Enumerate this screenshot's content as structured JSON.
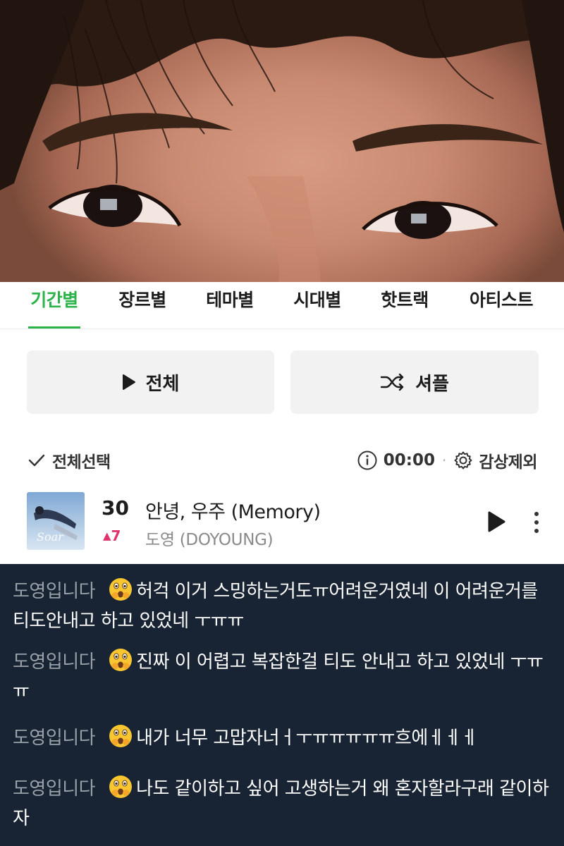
{
  "tabs": [
    {
      "label": "기간별",
      "active": true
    },
    {
      "label": "장르별",
      "active": false
    },
    {
      "label": "테마별",
      "active": false
    },
    {
      "label": "시대별",
      "active": false
    },
    {
      "label": "핫트랙",
      "active": false
    },
    {
      "label": "아티스트",
      "active": false
    }
  ],
  "accent_color": "#2bb34a",
  "buttons": {
    "play_all": {
      "label": "전체",
      "icon": "play-icon"
    },
    "shuffle": {
      "label": "셔플",
      "icon": "shuffle-icon"
    }
  },
  "toolbar": {
    "select_all": "전체선택",
    "time": "00:00",
    "exclude": "감상제외"
  },
  "song": {
    "rank": "30",
    "change": "7",
    "title": "안녕, 우주 (Memory)",
    "artist": "도영 (DOYOUNG)",
    "album_art_text": "Soar"
  },
  "comments": [
    {
      "name": "도영입니다",
      "emoji": "face-with-open-eyes-and-hand-over-mouth",
      "text": "허걱 이거 스밍하는거도ㅠ어려운거였네 이 어려운거를 티도안내고 하고 있었네 ㅜㅠㅠ"
    },
    {
      "name": "도영입니다",
      "emoji": "face-with-open-eyes-and-hand-over-mouth",
      "text": "진짜 이 어렵고 복잡한걸 티도 안내고 하고 있었네 ㅜㅠㅠ"
    },
    {
      "name": "도영입니다",
      "emoji": "face-with-open-eyes-and-hand-over-mouth",
      "text": "내가 너무 고맙자너ㅓㅜㅠㅠㅠㅠㅠ흐에ㅔㅔㅔ"
    },
    {
      "name": "도영입니다",
      "emoji": "face-with-open-eyes-and-hand-over-mouth",
      "text": "나도 같이하고 싶어 고생하는거 왜 혼자할라구래 같이하자"
    }
  ]
}
